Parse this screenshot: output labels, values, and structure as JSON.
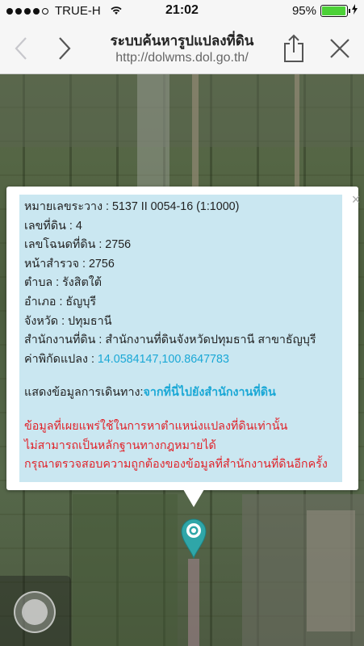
{
  "status_bar": {
    "carrier": "TRUE-H",
    "time": "21:02",
    "battery": "95%",
    "battery_level": 0.95
  },
  "navbar": {
    "title": "ระบบค้นหารูปแปลงที่ดิน",
    "url": "http://dolwms.dol.go.th/"
  },
  "popup": {
    "rows": [
      "หมายเลขระวาง : 5137 II 0054-16 (1:1000)",
      "เลขที่ดิน : 4",
      "เลขโฉนดที่ดิน : 2756",
      "หน้าสำรวจ : 2756",
      "ตำบล : รังสิตใต้",
      "อำเภอ : ธัญบุรี",
      "จังหวัด : ปทุมธานี",
      "สำนักงานที่ดิน : สำนักงานที่ดินจังหวัดปทุมธานี สาขาธัญบุรี"
    ],
    "coord_label": "ค่าพิกัดแปลง : ",
    "coord_value": "14.0584147,100.8647783",
    "route_label": "แสดงข้อมูลการเดินทาง:",
    "route_link": "จากที่นี่ไปยังสำนักงานที่ดิน",
    "warnings": [
      "ข้อมูลที่เผยแพร่ใช้ในการหาตำแหน่งแปลงที่ดินเท่านั้น",
      "ไม่สามารถเป็นหลักฐานทางกฎหมายได้",
      "กรุณาตรวจสอบความถูกต้องของข้อมูลที่สำนักงานที่ดินอีกครั้ง"
    ],
    "close_glyph": "×"
  },
  "icons": {
    "back": "chevron-left-icon",
    "forward": "chevron-right-icon",
    "share": "share-icon",
    "close": "close-icon",
    "marker": "map-pin-icon",
    "locate": "locate-icon"
  },
  "colors": {
    "popup_bg": "#cae7f1",
    "link": "#1aa8d6",
    "warning": "#e0242b",
    "marker": "#2fa6a8"
  }
}
